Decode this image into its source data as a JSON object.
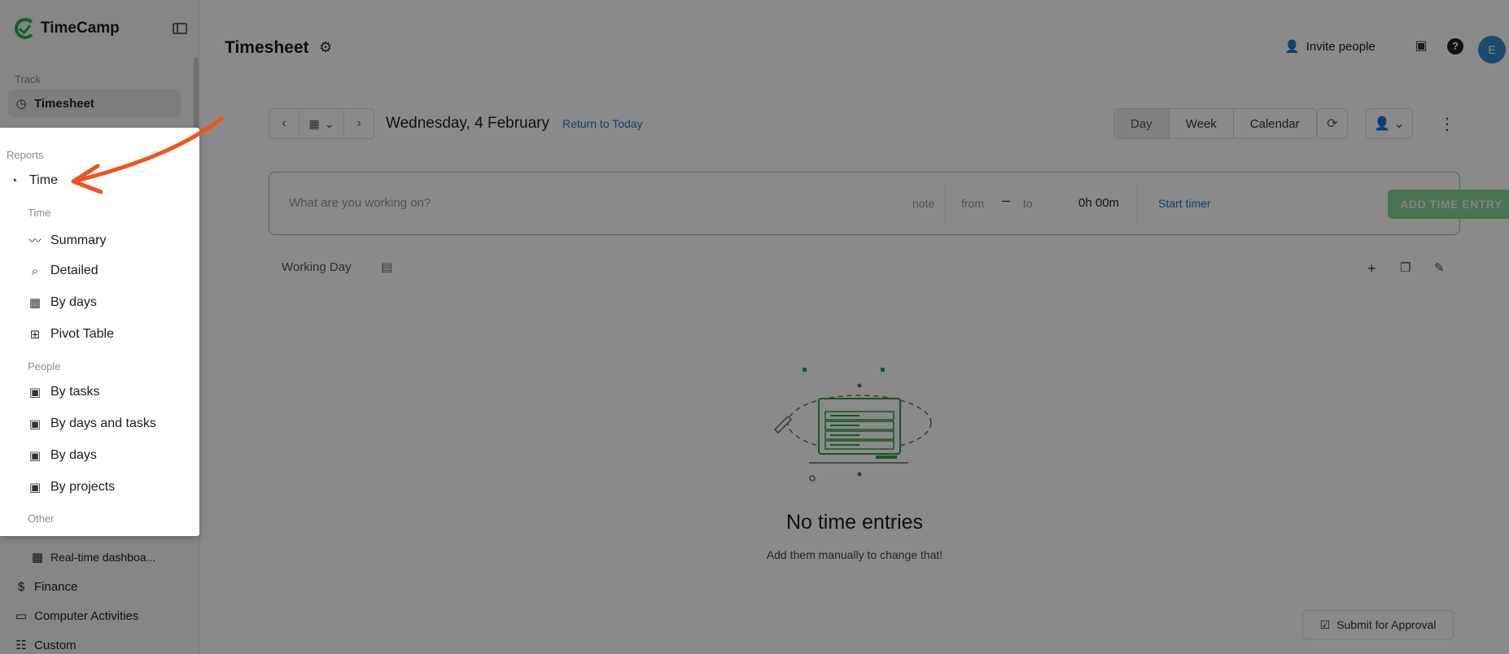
{
  "app": {
    "name": "TimeCamp"
  },
  "sidebar": {
    "sections": {
      "track": "Track"
    },
    "items": {
      "timesheet": "Timesheet",
      "realtime": "Real-time dashboa...",
      "finance": "Finance",
      "computer_activities": "Computer Activities",
      "custom": "Custom"
    }
  },
  "header": {
    "title": "Timesheet",
    "invite": "Invite people",
    "avatar_initial": "E"
  },
  "date_bar": {
    "date": "Wednesday, 4 February",
    "return_link": "Return to Today",
    "views": [
      "Day",
      "Week",
      "Calendar"
    ],
    "selected_view": "Day"
  },
  "entry": {
    "placeholder": "What are you working on?",
    "note": "note",
    "from": "from",
    "dash": "–",
    "to": "to",
    "duration": "0h 00m",
    "start_timer": "Start timer",
    "add_button": "ADD TIME ENTRY"
  },
  "working_day": "Working Day",
  "empty": {
    "title": "No time entries",
    "subtitle": "Add them manually to change that!"
  },
  "submit": "Submit for Approval",
  "popup": {
    "section": "Reports",
    "main_item": "Time",
    "groups": [
      {
        "label": "Time",
        "items": [
          "Summary",
          "Detailed",
          "By days",
          "Pivot Table"
        ]
      },
      {
        "label": "People",
        "items": [
          "By tasks",
          "By days and tasks",
          "By days",
          "By projects"
        ]
      },
      {
        "label": "Other",
        "items": []
      }
    ]
  },
  "colors": {
    "accent_green": "#25b04b",
    "link_blue": "#2a74c9",
    "arrow_orange": "#f0541e"
  }
}
